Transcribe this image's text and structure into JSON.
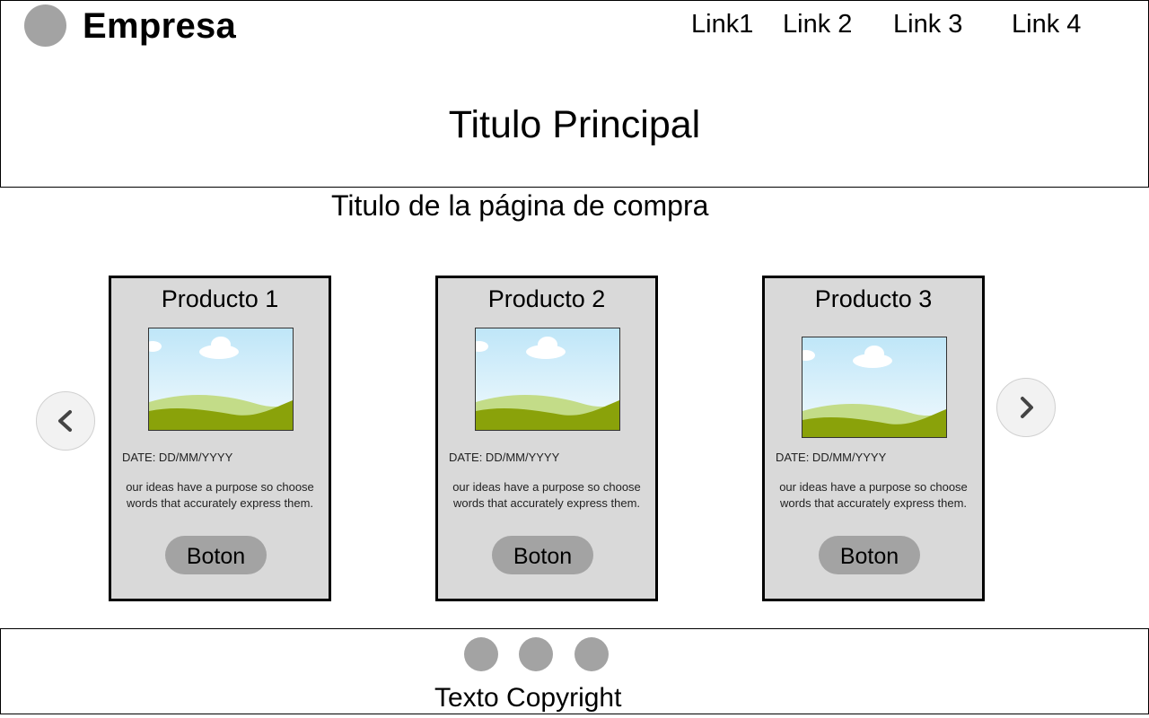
{
  "header": {
    "brand": "Empresa",
    "nav": [
      "Link1",
      "Link 2",
      "Link 3",
      "Link 4"
    ],
    "main_title": "Titulo Principal"
  },
  "page_title": "Titulo de la página de compra",
  "products": [
    {
      "title": "Producto 1",
      "date": "DATE: DD/MM/YYYY",
      "description": "our ideas have a purpose so choose words that accurately express them.",
      "button": "Boton"
    },
    {
      "title": "Producto 2",
      "date": "DATE: DD/MM/YYYY",
      "description": "our ideas have a purpose so choose words that accurately express them.",
      "button": "Boton"
    },
    {
      "title": "Producto 3",
      "date": "DATE: DD/MM/YYYY",
      "description": "our ideas have a purpose so choose words that accurately express them.",
      "button": "Boton"
    }
  ],
  "carousel": {
    "prev_icon": "chevron-left-icon",
    "next_icon": "chevron-right-icon"
  },
  "footer": {
    "social_icons": [
      "social-icon-1",
      "social-icon-2",
      "social-icon-3"
    ],
    "copyright": "Texto Copyright"
  },
  "colors": {
    "placeholder_gray": "#a3a3a3",
    "card_bg": "#d9d9d9",
    "sky": "#cdeaf7",
    "grass": "#8aa20a"
  }
}
